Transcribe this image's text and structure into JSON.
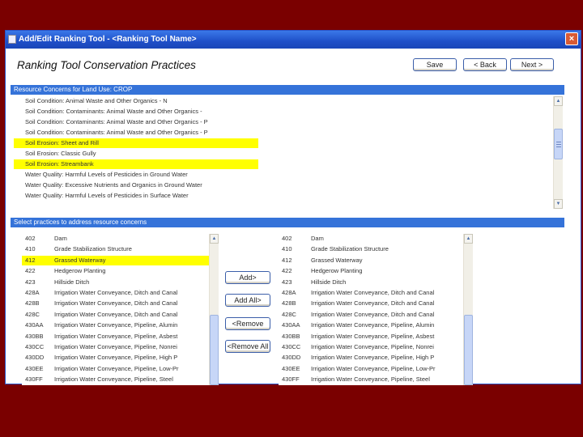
{
  "window": {
    "title": "Add/Edit Ranking Tool - <Ranking Tool Name>",
    "close_glyph": "×"
  },
  "page": {
    "heading": "Ranking Tool Conservation Practices"
  },
  "buttons": {
    "save": "Save",
    "back": "< Back",
    "next": "Next >",
    "add": "Add>",
    "add_all": "Add All>",
    "remove": "<Remove",
    "remove_all": "<Remove All"
  },
  "resource_concerns": {
    "header": "Resource Concerns for Land Use: CROP",
    "items": [
      {
        "text": "Soil Condition: Animal Waste and Other Organics - N",
        "highlighted": false
      },
      {
        "text": "Soil Condition: Contaminants: Animal Waste and Other Organics -",
        "highlighted": false
      },
      {
        "text": "Soil Condition: Contaminants: Animal Waste and Other Organics - P",
        "highlighted": false
      },
      {
        "text": "Soil Condition: Contaminants: Animal Waste and Other Organics - P",
        "highlighted": false
      },
      {
        "text": "Soil Erosion: Sheet and Rill",
        "highlighted": true
      },
      {
        "text": "Soil Erosion: Classic Gully",
        "highlighted": false
      },
      {
        "text": "Soil Erosion: Streambank",
        "highlighted": true
      },
      {
        "text": "Water Quality: Harmful Levels of Pesticides in Ground Water",
        "highlighted": false
      },
      {
        "text": "Water Quality: Excessive Nutrients and Organics in Ground Water",
        "highlighted": false
      },
      {
        "text": "Water Quality: Harmful Levels of Pesticides in Surface Water",
        "highlighted": false
      }
    ]
  },
  "practices": {
    "header": "Select practices to address resource concerns",
    "available": [
      {
        "code": "402",
        "name": "Dam",
        "highlighted": false
      },
      {
        "code": "410",
        "name": "Grade Stabilization Structure",
        "highlighted": false
      },
      {
        "code": "412",
        "name": "Grassed Waterway",
        "highlighted": true
      },
      {
        "code": "422",
        "name": "Hedgerow Planting",
        "highlighted": false
      },
      {
        "code": "423",
        "name": "Hillside Ditch",
        "highlighted": false
      },
      {
        "code": "428A",
        "name": "Irrigation Water Conveyance, Ditch and Canal",
        "highlighted": false
      },
      {
        "code": "428B",
        "name": "Irrigation Water Conveyance, Ditch and Canal",
        "highlighted": false
      },
      {
        "code": "428C",
        "name": "Irrigation Water Conveyance, Ditch and Canal",
        "highlighted": false
      },
      {
        "code": "430AA",
        "name": "Irrigation Water Conveyance, Pipeline, Alumin",
        "highlighted": false
      },
      {
        "code": "430BB",
        "name": "Irrigation Water Conveyance, Pipeline, Asbest",
        "highlighted": false
      },
      {
        "code": "430CC",
        "name": "Irrigation Water Conveyance, Pipeline, Nonrei",
        "highlighted": false
      },
      {
        "code": "430DD",
        "name": "Irrigation Water Conveyance, Pipeline, High P",
        "highlighted": false
      },
      {
        "code": "430EE",
        "name": "Irrigation Water Conveyance, Pipeline, Low-Pr",
        "highlighted": false
      },
      {
        "code": "430FF",
        "name": "Irrigation Water Conveyance, Pipeline, Steel",
        "highlighted": false
      }
    ],
    "selected": [
      {
        "code": "402",
        "name": "Dam",
        "highlighted": false
      },
      {
        "code": "410",
        "name": "Grade Stabilization Structure",
        "highlighted": false
      },
      {
        "code": "412",
        "name": "Grassed Waterway",
        "highlighted": false
      },
      {
        "code": "422",
        "name": "Hedgerow Planting",
        "highlighted": false
      },
      {
        "code": "423",
        "name": "Hillside Ditch",
        "highlighted": false
      },
      {
        "code": "428A",
        "name": "Irrigation Water Conveyance, Ditch and Canal",
        "highlighted": false
      },
      {
        "code": "428B",
        "name": "Irrigation Water Conveyance, Ditch and Canal",
        "highlighted": false
      },
      {
        "code": "428C",
        "name": "Irrigation Water Conveyance, Ditch and Canal",
        "highlighted": false
      },
      {
        "code": "430AA",
        "name": "Irrigation Water Conveyance, Pipeline, Alumin",
        "highlighted": false
      },
      {
        "code": "430BB",
        "name": "Irrigation Water Conveyance, Pipeline, Asbest",
        "highlighted": false
      },
      {
        "code": "430CC",
        "name": "Irrigation Water Conveyance, Pipeline, Nonrei",
        "highlighted": false
      },
      {
        "code": "430DD",
        "name": "Irrigation Water Conveyance, Pipeline, High P",
        "highlighted": false
      },
      {
        "code": "430EE",
        "name": "Irrigation Water Conveyance, Pipeline, Low-Pr",
        "highlighted": false
      },
      {
        "code": "430FF",
        "name": "Irrigation Water Conveyance, Pipeline, Steel",
        "highlighted": false
      }
    ]
  },
  "colors": {
    "slide_background": "#7a0000",
    "section_bar": "#3573d9",
    "highlight": "#ffff00",
    "titlebar": "#1f4fc8"
  }
}
